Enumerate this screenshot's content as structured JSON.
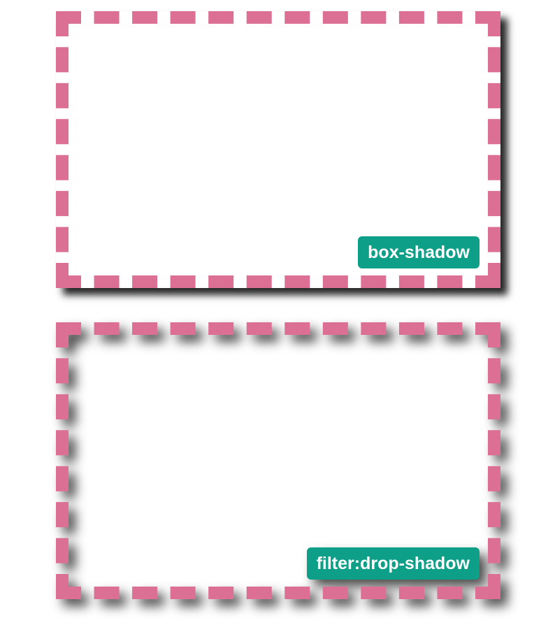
{
  "boxes": [
    {
      "label": "box-shadow"
    },
    {
      "label": "filter:drop-shadow"
    }
  ],
  "colors": {
    "border": "#dc6f94",
    "label_background": "#0e9f88",
    "label_text": "#ffffff",
    "page_background": "#ffffff"
  }
}
